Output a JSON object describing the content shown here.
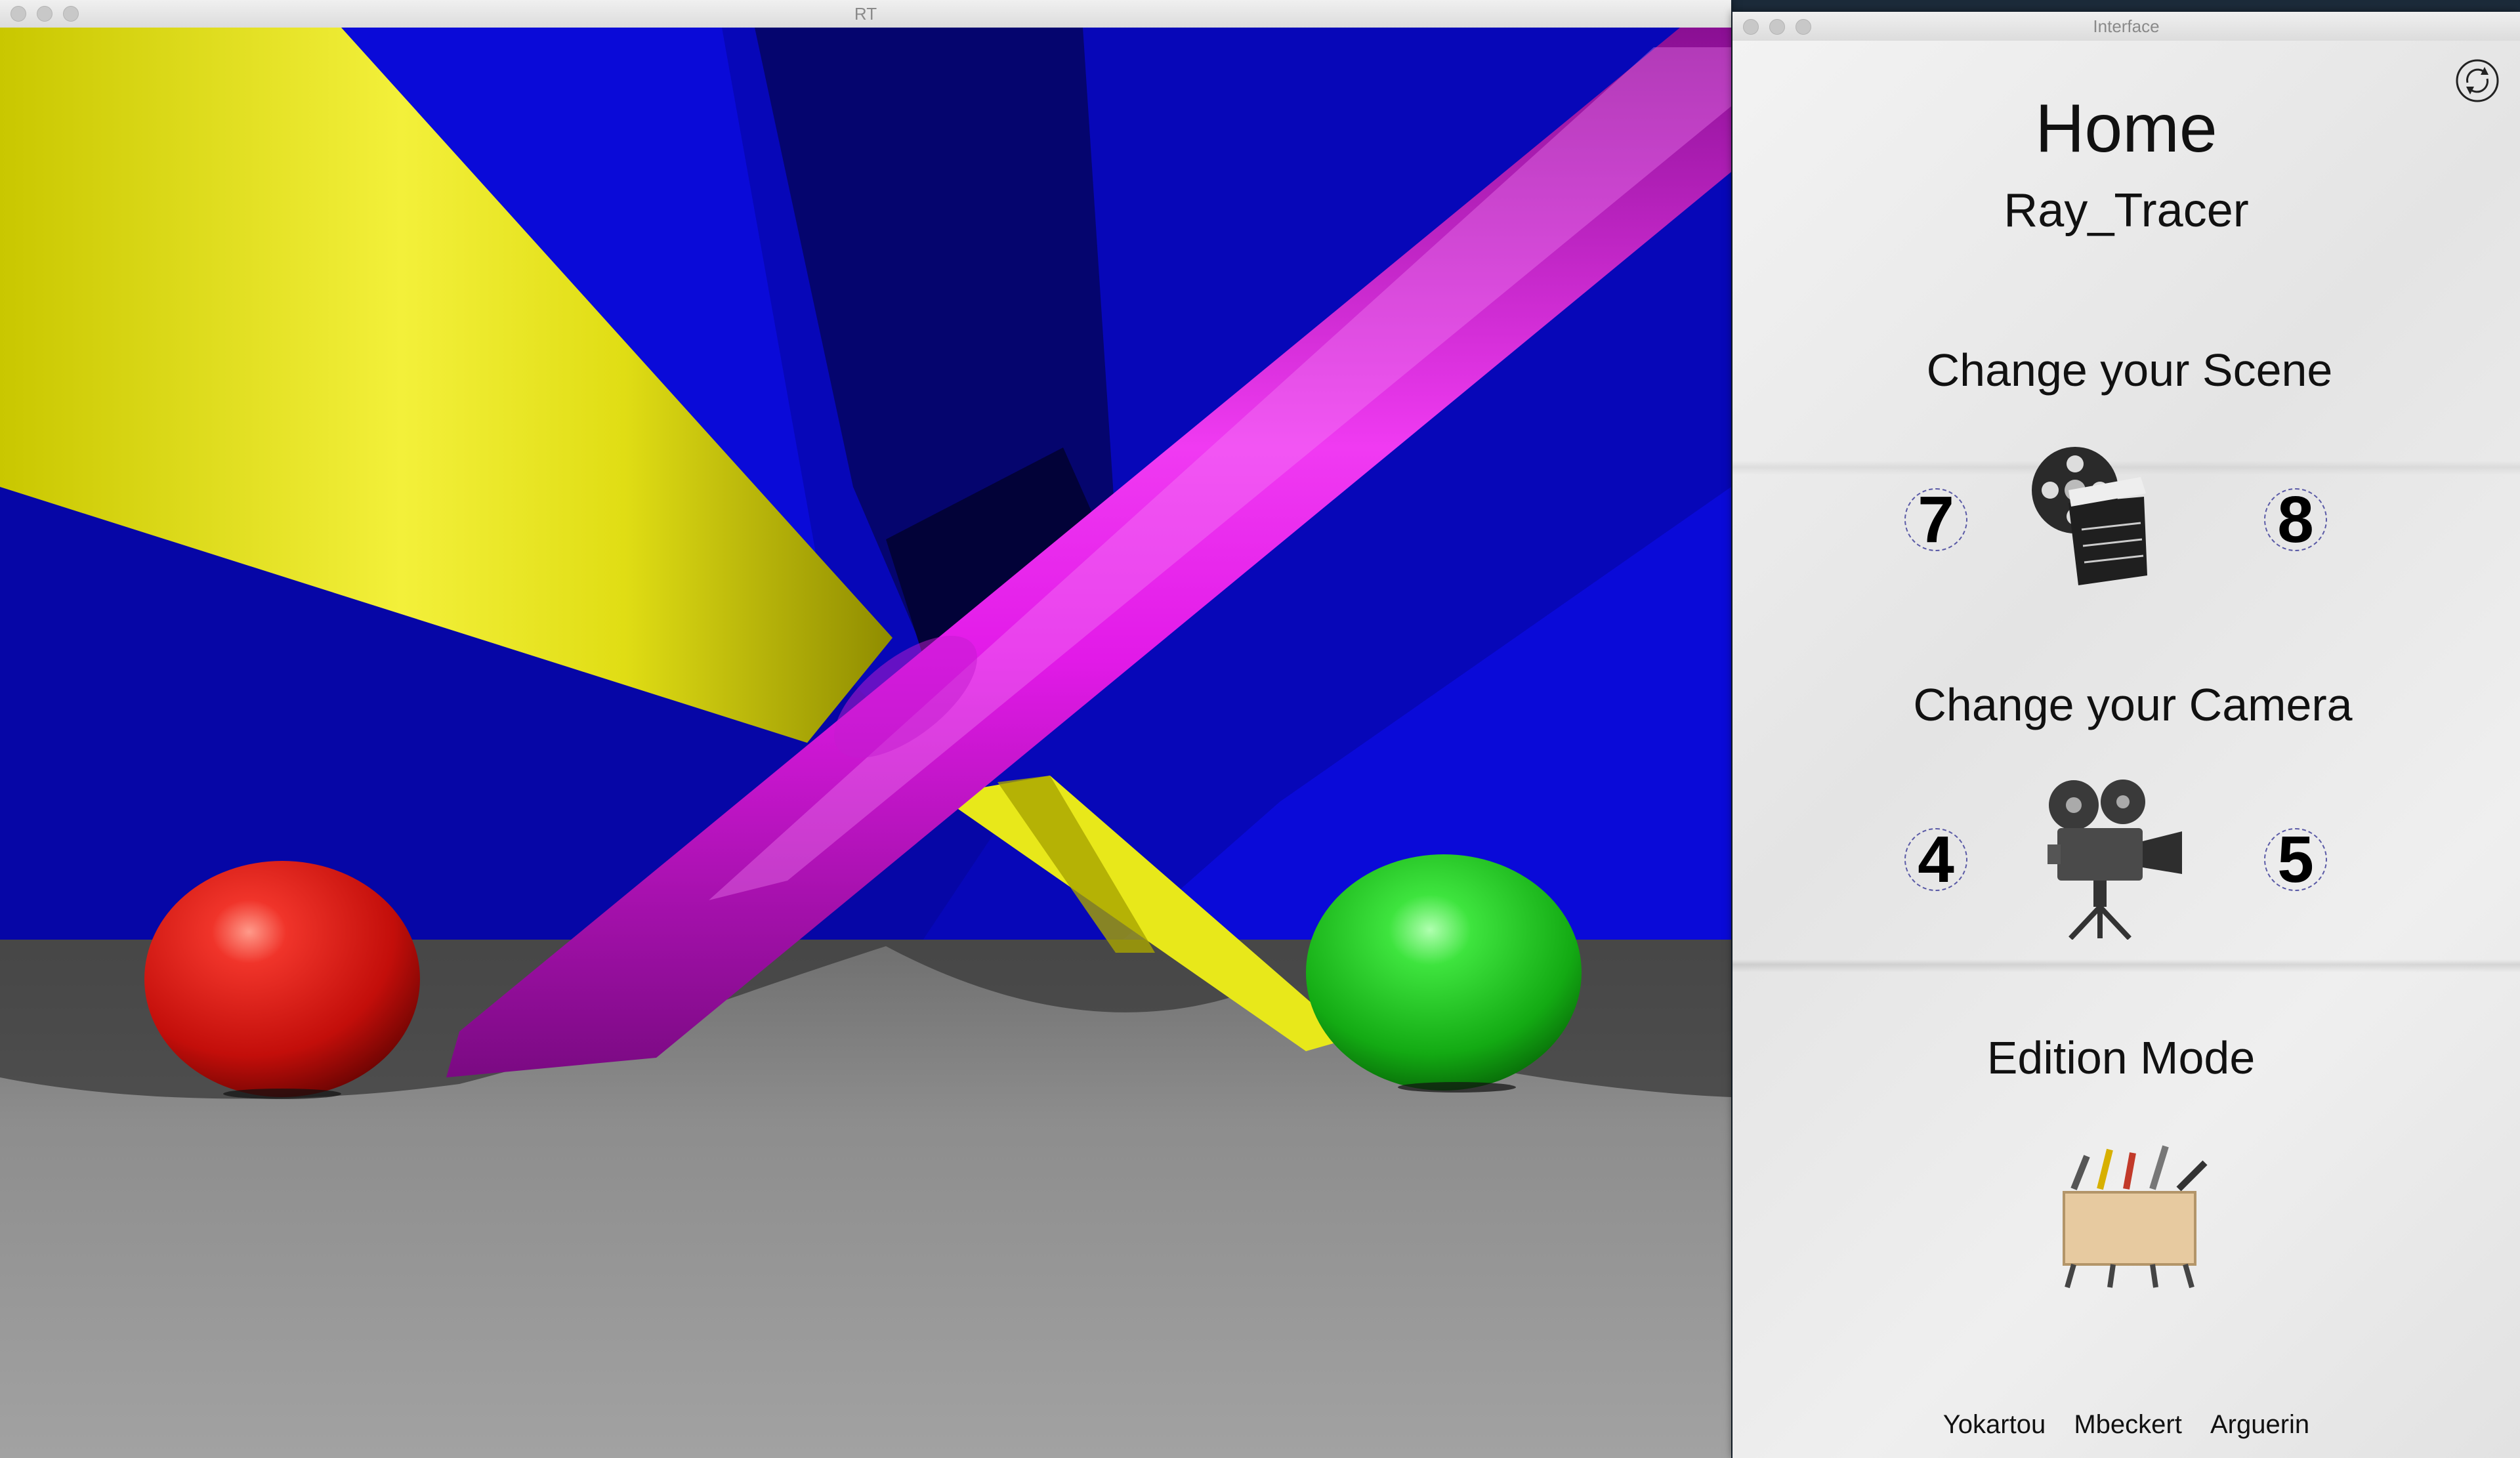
{
  "rt_window": {
    "title": "RT"
  },
  "interface": {
    "window_title": "Interface",
    "home_title": "Home",
    "app_name": "Ray_Tracer",
    "scene": {
      "title": "Change your Scene",
      "prev": "7",
      "next": "8"
    },
    "camera": {
      "title": "Change your Camera",
      "prev": "4",
      "next": "5"
    },
    "edition": {
      "title": "Edition Mode"
    },
    "credits": [
      "Yokartou",
      "Mbeckert",
      "Arguerin"
    ]
  },
  "icons": [
    "refresh-icon",
    "film-clapper-icon",
    "movie-camera-icon",
    "toolbox-icon"
  ],
  "colors": {
    "sky": "#0a0ad8",
    "floor": "#8c8c8c",
    "yellow_cone": "#e8e81a",
    "magenta_cylinder": "#e21ae8",
    "red_sphere": "#e41a14",
    "green_sphere": "#1ac81a"
  }
}
